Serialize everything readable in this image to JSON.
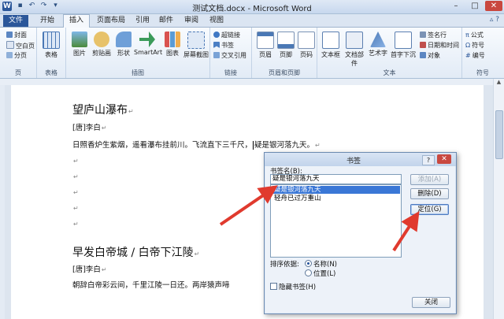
{
  "window": {
    "title": "测试文档.docx - Microsoft Word",
    "app_icon_letter": "W"
  },
  "tabs": [
    "文件",
    "开始",
    "插入",
    "页面布局",
    "引用",
    "邮件",
    "审阅",
    "视图"
  ],
  "ribbon": {
    "pages": {
      "items": [
        "封面",
        "空白页",
        "分页"
      ],
      "label": "页"
    },
    "tables": {
      "button": "表格",
      "label": "表格"
    },
    "illustrations": {
      "buttons": [
        "图片",
        "剪贴画",
        "形状",
        "SmartArt",
        "图表",
        "屏幕截图"
      ],
      "label": "插图"
    },
    "links": {
      "items": [
        "超链接",
        "书签",
        "交叉引用"
      ],
      "label": "链接"
    },
    "header_footer": {
      "buttons": [
        "页眉",
        "页脚",
        "页码"
      ],
      "label": "页眉和页脚"
    },
    "text": {
      "buttons": [
        "文本框",
        "文档部件",
        "艺术字",
        "首字下沉"
      ],
      "items": [
        "签名行",
        "日期和时间",
        "对象"
      ],
      "label": "文本"
    },
    "symbols": {
      "items": [
        "公式",
        "符号",
        "编号"
      ],
      "label": "符号"
    }
  },
  "document": {
    "poem1_title": "望庐山瀑布",
    "poem1_author": "[唐]李白",
    "poem1_text": "日照香炉生紫烟，遥看瀑布挂前川。飞流直下三千尺，",
    "poem1_text_tail": "疑是银河落九天。",
    "poem2_title": "早发白帝城 / 白帝下江陵",
    "poem2_author": "[唐]李白",
    "poem2_text": "朝辞白帝彩云间，千里江陵一日还。两岸猿声啼"
  },
  "bookmark_dialog": {
    "title": "书签",
    "help": "?",
    "close": "✕",
    "name_label": "书签名(B):",
    "name_value": "疑是银河落九天",
    "list": [
      "疑是银河落九天",
      "轻舟已过万重山"
    ],
    "buttons": {
      "add": "添加(A)",
      "delete": "删除(D)",
      "goto": "定位(G)",
      "close": "关闭"
    },
    "sort_label": "排序依据:",
    "sort_name": "名称(N)",
    "sort_location": "位置(L)",
    "hidden_label": "隐藏书签(H)"
  },
  "colors": {
    "accent": "#2b579a",
    "selection": "#3a77d6",
    "annotation_arrow": "#e03a2e"
  }
}
